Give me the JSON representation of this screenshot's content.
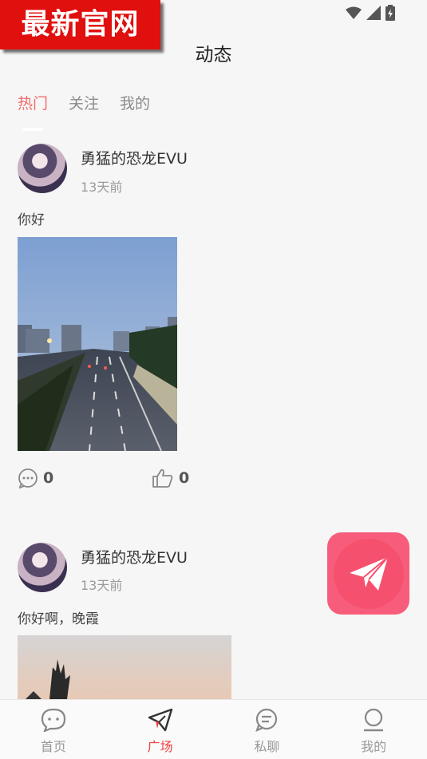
{
  "watermark": "最新官网",
  "header": {
    "title": "动态"
  },
  "tabs": [
    {
      "label": "热门",
      "active": true
    },
    {
      "label": "关注",
      "active": false
    },
    {
      "label": "我的",
      "active": false
    }
  ],
  "posts": [
    {
      "author": "勇猛的恐龙EVU",
      "time": "13天前",
      "content": "你好",
      "comments": "0",
      "likes": "0"
    },
    {
      "author": "勇猛的恐龙EVU",
      "time": "13天前",
      "content": "你好啊，晚霞"
    }
  ],
  "fab": {
    "icon": "paper-plane-icon",
    "color": "#f75d7a"
  },
  "bottom_nav": [
    {
      "label": "首页",
      "icon": "chat-bubble-icon",
      "active": false
    },
    {
      "label": "广场",
      "icon": "paper-plane-icon",
      "active": true
    },
    {
      "label": "私聊",
      "icon": "message-icon",
      "active": false
    },
    {
      "label": "我的",
      "icon": "person-icon",
      "active": false
    }
  ],
  "colors": {
    "accent": "#f26d6d",
    "nav_active": "#f04040"
  }
}
